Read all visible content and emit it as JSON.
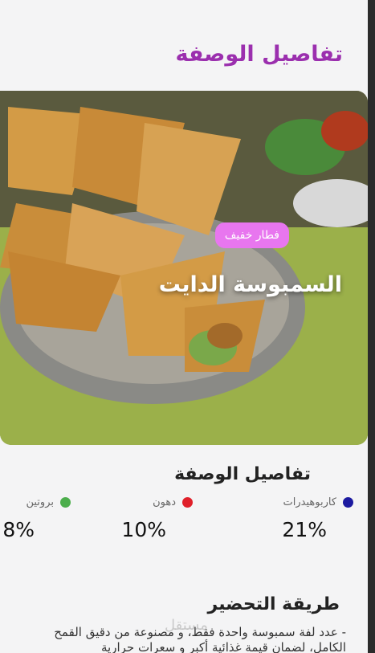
{
  "page": {
    "title": "تفاصيل الوصفة"
  },
  "hero": {
    "badge": "فطار خفيف",
    "recipe_name": "السمبوسة الدايت"
  },
  "details": {
    "section_title": "تفاصيل الوصفة",
    "nutrients": [
      {
        "label": "كاربوهيدرات",
        "value": "21%",
        "color": "#1c1aa0"
      },
      {
        "label": "دهون",
        "value": "10%",
        "color": "#e0202a"
      },
      {
        "label": "بروتين",
        "value": "8%",
        "color": "#4cae4c"
      }
    ]
  },
  "preparation": {
    "title": "طريقة التحضير",
    "text": "- عدد لفة سمبوسة واحدة فقط، و مصنوعة من دقيق القمح الكامل، لضمان قيمة غذائية أكبر و سعرات حرارية"
  },
  "watermark": "مستقل"
}
